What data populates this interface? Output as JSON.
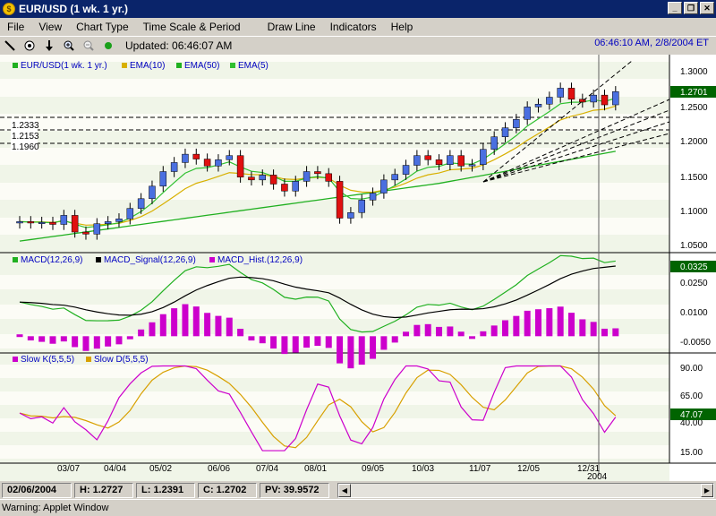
{
  "window": {
    "title": "EUR/USD (1 wk.  1 yr.)",
    "minimize": "_",
    "restore": "❐",
    "close": "✕"
  },
  "menu": [
    "File",
    "View",
    "Chart Type",
    "Time Scale & Period",
    "Draw Line",
    "Indicators",
    "Help"
  ],
  "toolbar": {
    "updated": "Updated: 06:46:07 AM",
    "clock": "06:46:10 AM, 2/8/2004 ET",
    "icons": [
      "line-tool-icon",
      "crosshair-icon",
      "arrow-down-icon",
      "zoom-in-icon",
      "zoom-out-icon",
      "status-light-icon"
    ]
  },
  "colors": {
    "up": "#4a6fe0",
    "down": "#e01010",
    "ema10": "#d8b000",
    "ema50": "#20b020",
    "ema5": "#30c030",
    "macd": "#20b020",
    "signal": "#000000",
    "hist": "#cc00cc",
    "slowk": "#cc00cc",
    "slowd": "#d8a000"
  },
  "panels": {
    "price": {
      "legend": [
        "EUR/USD(1 wk.  1 yr.)",
        "EMA(10)",
        "EMA(50)",
        "EMA(5)"
      ],
      "ticks": [
        "1.3000",
        "1.2500",
        "1.2000",
        "1.1500",
        "1.1000",
        "1.0500"
      ],
      "last": "1.2701",
      "levels": [
        "1.2333",
        "1.2153",
        "1.1960"
      ]
    },
    "macd": {
      "legend": [
        "MACD(12,26,9)",
        "MACD_Signal(12,26,9)",
        "MACD_Hist.(12,26,9)"
      ],
      "ticks": [
        "0.0250",
        "0.0100",
        "-0.0050"
      ],
      "last": "0.0325"
    },
    "stoch": {
      "legend": [
        "Slow K(5,5,5)",
        "Slow D(5,5,5)"
      ],
      "ticks": [
        "90.00",
        "65.00",
        "40.00",
        "15.00"
      ],
      "last": "47.07"
    }
  },
  "x_labels": [
    "03/07",
    "04/04",
    "05/02",
    "06/06",
    "07/04",
    "08/01",
    "09/05",
    "10/03",
    "11/07",
    "12/05",
    "12/31"
  ],
  "x_year": "2004",
  "chart_data": {
    "type": "candlestick",
    "closes": [
      1.083,
      1.081,
      1.082,
      1.079,
      1.092,
      1.068,
      1.065,
      1.08,
      1.083,
      1.087,
      1.102,
      1.116,
      1.134,
      1.155,
      1.168,
      1.18,
      1.173,
      1.163,
      1.172,
      1.178,
      1.147,
      1.143,
      1.15,
      1.137,
      1.127,
      1.141,
      1.155,
      1.152,
      1.141,
      1.088,
      1.096,
      1.114,
      1.124,
      1.143,
      1.151,
      1.164,
      1.178,
      1.172,
      1.165,
      1.178,
      1.163,
      1.165,
      1.187,
      1.205,
      1.218,
      1.23,
      1.248,
      1.252,
      1.262,
      1.275,
      1.259,
      1.255,
      1.265,
      1.251,
      1.27
    ]
  },
  "status": {
    "date": "02/06/2004",
    "high": "H: 1.2727",
    "low": "L: 1.2391",
    "close": "C: 1.2702",
    "pv": "PV: 39.9572"
  },
  "warning": "Warning: Applet Window"
}
